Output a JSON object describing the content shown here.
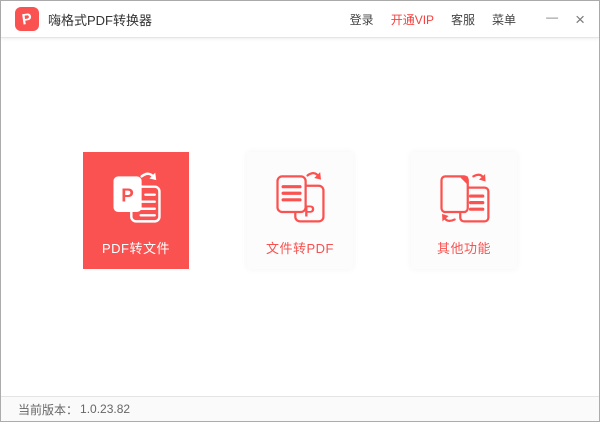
{
  "window": {
    "title": "嗨格式PDF转换器",
    "logo_letter": "P",
    "version_label": "当前版本：",
    "version": "1.0.23.82"
  },
  "titlebar": {
    "menu_items": [
      {
        "label": "登录",
        "accent": false
      },
      {
        "label": "开通VIP",
        "accent": true
      },
      {
        "label": "客服",
        "accent": false
      },
      {
        "label": "菜单",
        "accent": false
      }
    ],
    "minimize_glyph": "—",
    "close_glyph": "×"
  },
  "cards": [
    {
      "label": "PDF转文件",
      "style": "primary",
      "icon": "pdf-to-file-icon",
      "icon_letter": "P"
    },
    {
      "label": "文件转PDF",
      "style": "light",
      "icon": "file-to-pdf-icon",
      "icon_letter": "P"
    },
    {
      "label": "其他功能",
      "style": "light",
      "icon": "other-functions-icon"
    }
  ],
  "colors": {
    "accent": "#FA5250",
    "accent_text": "#F7524F",
    "vip": "#F73F3D",
    "title_text": "#333333",
    "menu_text": "#454545",
    "muted": "#666666",
    "control": "#7A7A7A",
    "card_bg": "#FCFCFC"
  }
}
